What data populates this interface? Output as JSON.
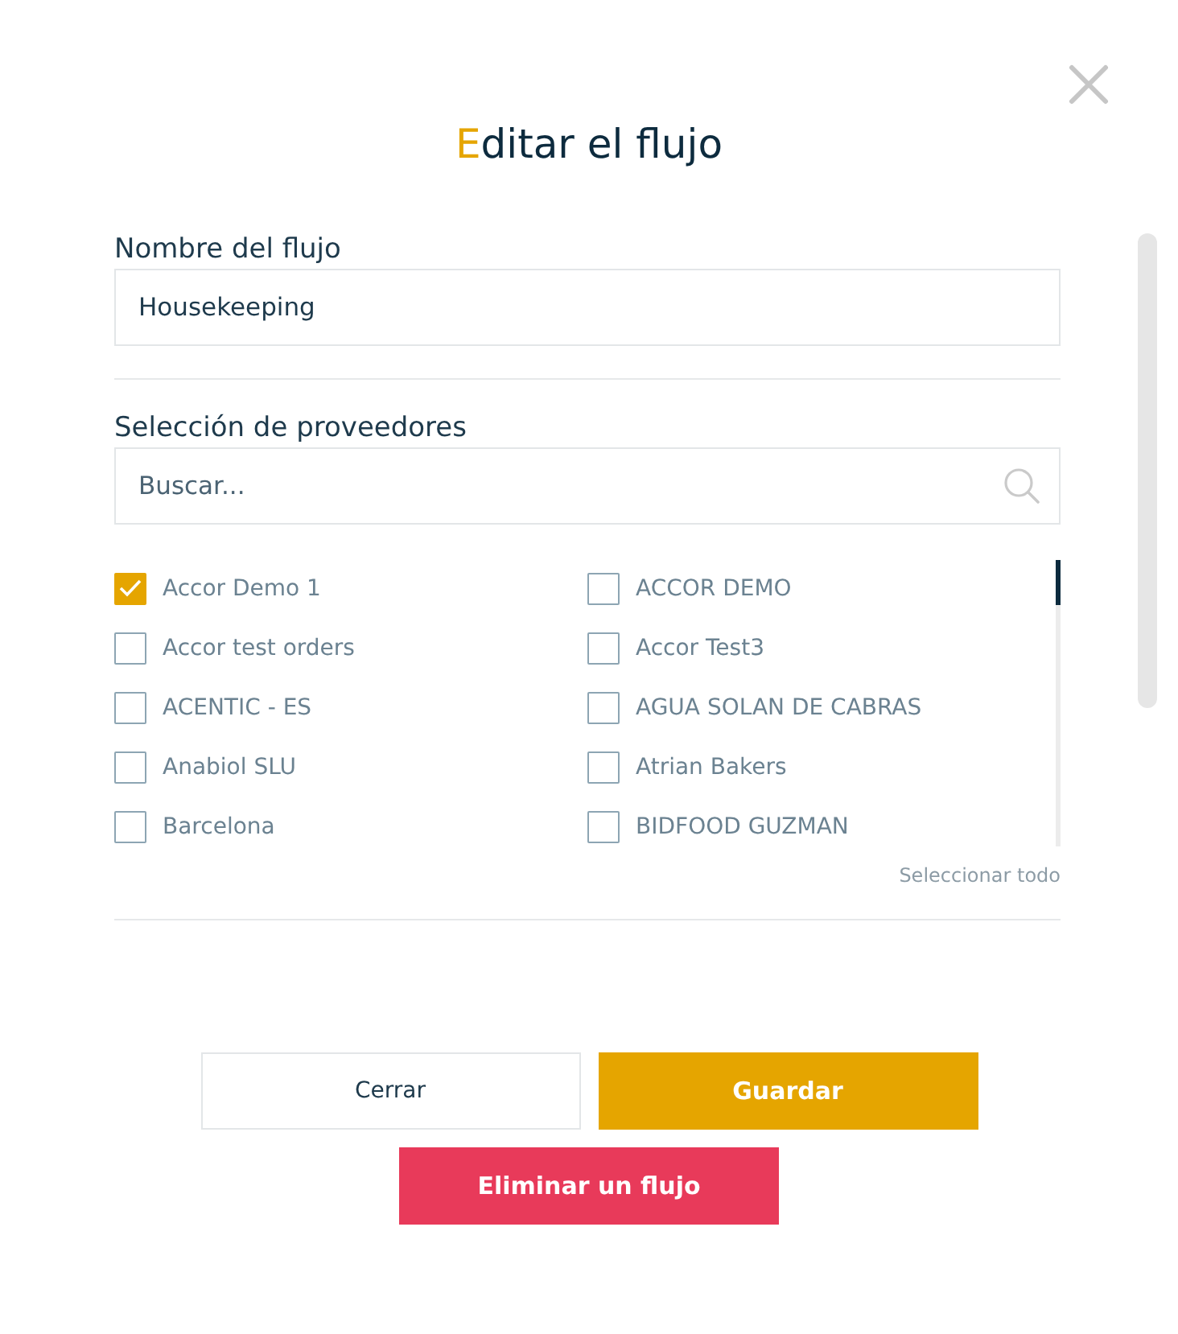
{
  "dialog": {
    "title": "Editar el flujo"
  },
  "name_field": {
    "label": "Nombre del flujo",
    "value": "Housekeeping"
  },
  "suppliers": {
    "label": "Selección de proveedores",
    "search": {
      "placeholder": "Buscar..."
    },
    "items": [
      {
        "label": "Accor Demo 1",
        "checked": true
      },
      {
        "label": "ACCOR DEMO",
        "checked": false
      },
      {
        "label": "Accor test orders",
        "checked": false
      },
      {
        "label": "Accor Test3",
        "checked": false
      },
      {
        "label": "ACENTIC - ES",
        "checked": false
      },
      {
        "label": "AGUA SOLAN DE CABRAS",
        "checked": false
      },
      {
        "label": "Anabiol SLU",
        "checked": false
      },
      {
        "label": "Atrian Bakers",
        "checked": false
      },
      {
        "label": "Barcelona",
        "checked": false
      },
      {
        "label": "BIDFOOD GUZMAN",
        "checked": false
      }
    ],
    "select_all": "Seleccionar todo"
  },
  "buttons": [
    {
      "label": "Cerrar",
      "kind": "secondary"
    },
    {
      "label": "Guardar",
      "kind": "primary"
    },
    {
      "label": "Eliminar un flujo",
      "kind": "danger"
    }
  ]
}
